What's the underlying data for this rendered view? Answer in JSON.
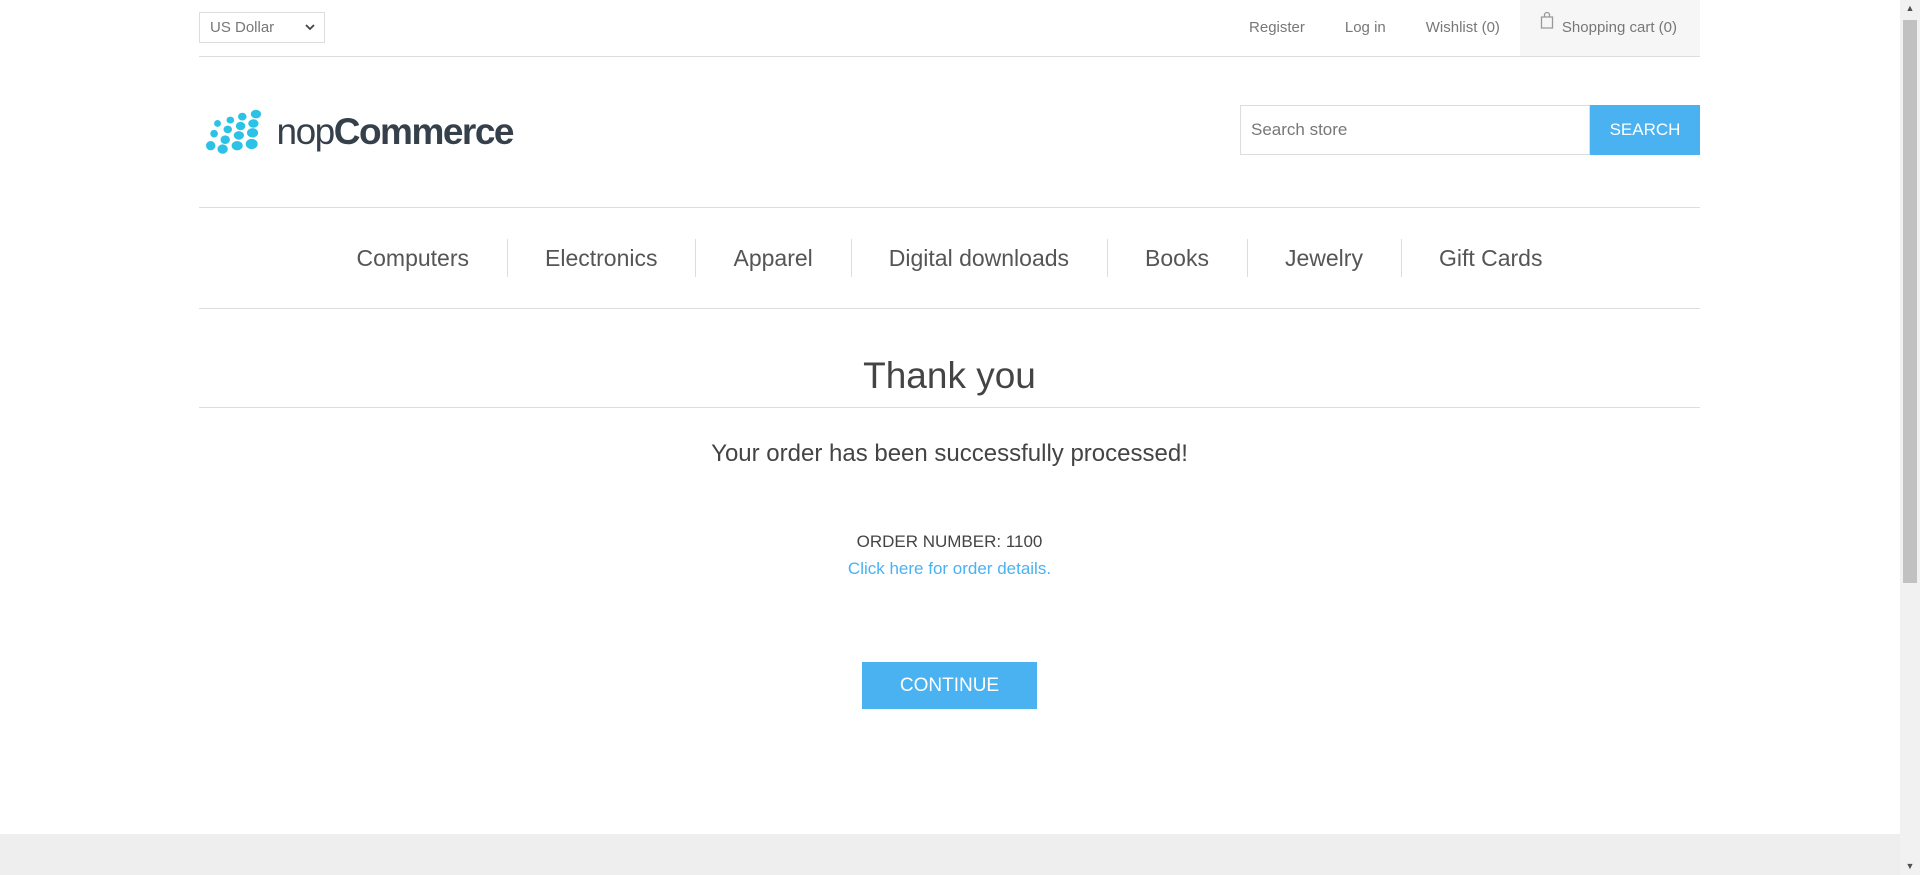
{
  "header": {
    "currency": "US Dollar",
    "links": {
      "register": "Register",
      "login": "Log in",
      "wishlist": "Wishlist (0)",
      "cart": "Shopping cart (0)"
    }
  },
  "logo": {
    "light": "nop",
    "bold": "Commerce"
  },
  "search": {
    "placeholder": "Search store",
    "button": "Search"
  },
  "menu": [
    "Computers",
    "Electronics",
    "Apparel",
    "Digital downloads",
    "Books",
    "Jewelry",
    "Gift Cards"
  ],
  "content": {
    "title": "Thank you",
    "message": "Your order has been successfully processed!",
    "order_number": "ORDER NUMBER: 1100",
    "details_link": "Click here for order details.",
    "continue": "Continue"
  },
  "colors": {
    "accent": "#4ab2f1",
    "logo_dots": "#2cc2e6",
    "logo_text": "#35404b"
  }
}
